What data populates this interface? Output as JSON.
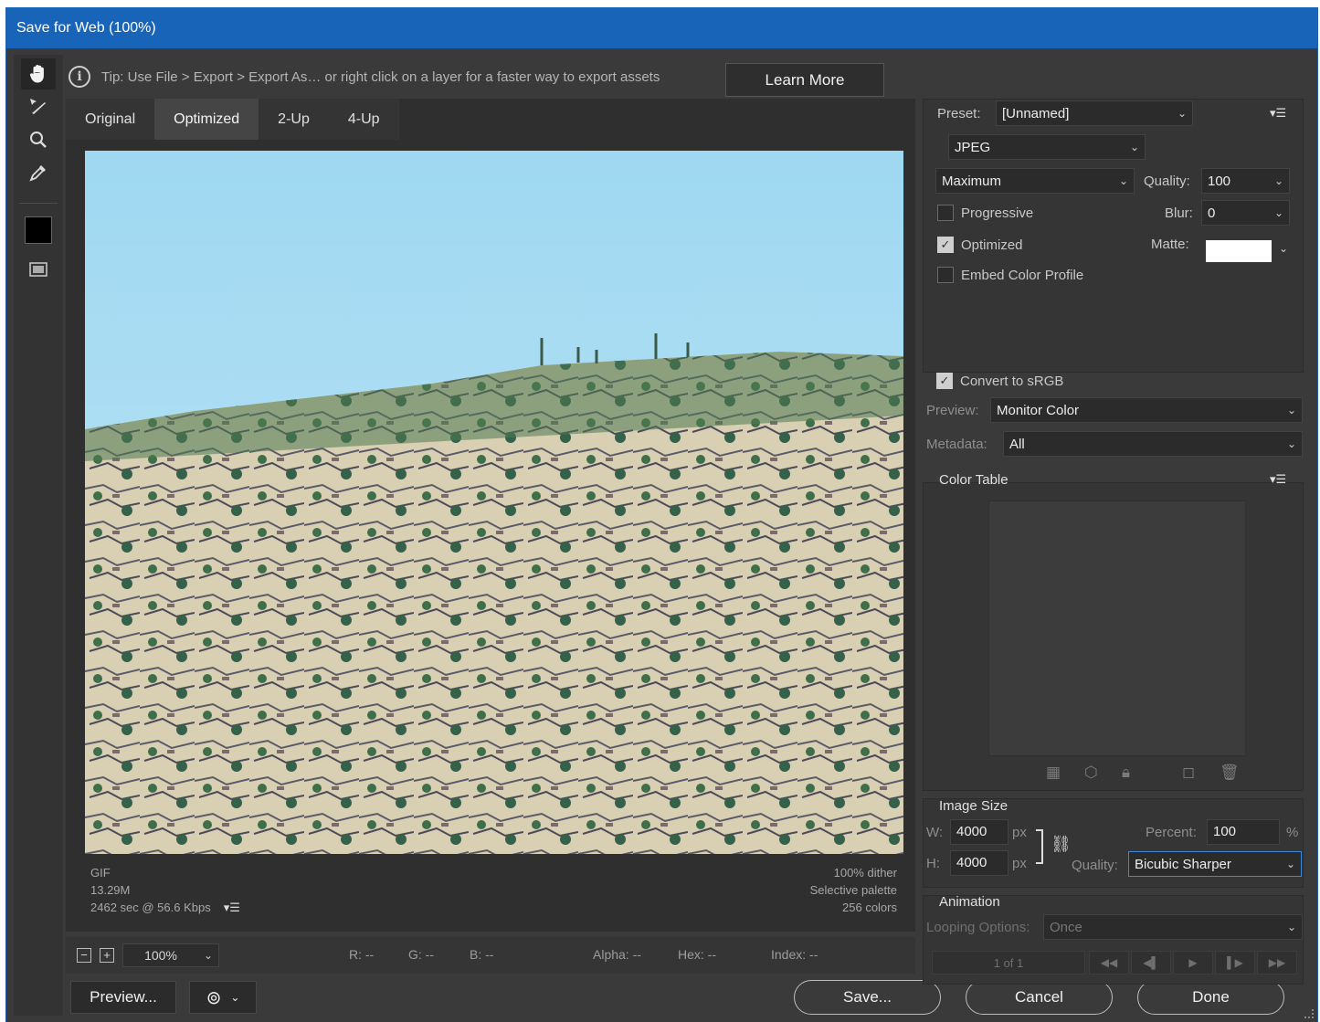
{
  "window": {
    "title": "Save for Web (100%)"
  },
  "tip": {
    "text": "Tip: Use File > Export > Export As…  or right click on a layer for a faster way to export assets",
    "learn_more": "Learn More"
  },
  "tools": [
    "hand-tool",
    "slice-select-tool",
    "zoom-tool",
    "eyedropper-tool",
    "eyedropper-color",
    "toggle-slices"
  ],
  "tabs": [
    "Original",
    "Optimized",
    "2-Up",
    "4-Up"
  ],
  "active_tab": "Optimized",
  "image_info": {
    "format": "GIF",
    "size": "13.29M",
    "time": "2462 sec @ 56.6 Kbps",
    "dither": "100% dither",
    "palette": "Selective palette",
    "colors": "256 colors"
  },
  "status": {
    "zoom": "100%",
    "r": "R: --",
    "g": "G: --",
    "b": "B: --",
    "alpha": "Alpha: --",
    "hex": "Hex: --",
    "index": "Index: --"
  },
  "bottom": {
    "preview": "Preview...",
    "save": "Save...",
    "cancel": "Cancel",
    "done": "Done"
  },
  "settings": {
    "preset_label": "Preset:",
    "preset_value": "[Unnamed]",
    "format": "JPEG",
    "compression": "Maximum",
    "quality_label": "Quality:",
    "quality_value": "100",
    "progressive": "Progressive",
    "progressive_checked": false,
    "blur_label": "Blur:",
    "blur_value": "0",
    "optimized": "Optimized",
    "optimized_checked": true,
    "matte_label": "Matte:",
    "matte_color": "#ffffff",
    "embed_profile": "Embed Color Profile",
    "embed_checked": false,
    "convert_srgb": "Convert to sRGB",
    "convert_checked": true,
    "preview_label": "Preview:",
    "preview_value": "Monitor Color",
    "metadata_label": "Metadata:",
    "metadata_value": "All"
  },
  "color_table": {
    "title": "Color Table"
  },
  "image_size": {
    "title": "Image Size",
    "w_label": "W:",
    "w_value": "4000",
    "h_label": "H:",
    "h_value": "4000",
    "unit": "px",
    "percent_label": "Percent:",
    "percent_value": "100",
    "percent_unit": "%",
    "quality_label": "Quality:",
    "quality_value": "Bicubic Sharper"
  },
  "animation": {
    "title": "Animation",
    "looping_label": "Looping Options:",
    "looping_value": "Once",
    "frame": "1 of 1"
  },
  "colors": {
    "titlebar": "#1864b8",
    "panel": "#3a3a3a",
    "focus": "#3d86d6"
  }
}
